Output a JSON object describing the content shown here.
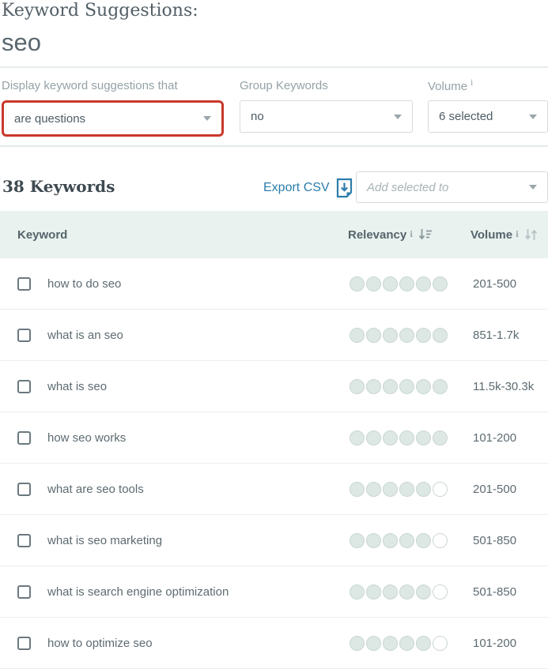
{
  "page": {
    "title": "Keyword Suggestions:",
    "query": "seo"
  },
  "filters": {
    "display": {
      "label": "Display keyword suggestions that",
      "value": "are questions",
      "highlighted": true
    },
    "group": {
      "label": "Group Keywords",
      "value": "no"
    },
    "volume": {
      "label": "Volume",
      "info_icon": "i",
      "value": "6 selected"
    }
  },
  "results": {
    "count_label": "38 Keywords",
    "export_label": "Export CSV",
    "add_selected_placeholder": "Add selected to"
  },
  "table": {
    "headers": {
      "keyword": "Keyword",
      "relevancy": "Relevancy",
      "relevancy_info_icon": "i",
      "volume": "Volume",
      "volume_info_icon": "i"
    },
    "relevancy_max": 6,
    "rows": [
      {
        "keyword": "how to do seo",
        "relevancy": 6,
        "volume": "201-500"
      },
      {
        "keyword": "what is an seo",
        "relevancy": 6,
        "volume": "851-1.7k"
      },
      {
        "keyword": "what is seo",
        "relevancy": 6,
        "volume": "11.5k-30.3k"
      },
      {
        "keyword": "how seo works",
        "relevancy": 6,
        "volume": "101-200"
      },
      {
        "keyword": "what are seo tools",
        "relevancy": 5,
        "volume": "201-500"
      },
      {
        "keyword": "what is seo marketing",
        "relevancy": 5,
        "volume": "501-850"
      },
      {
        "keyword": "what is search engine optimization",
        "relevancy": 5,
        "volume": "501-850"
      },
      {
        "keyword": "how to optimize seo",
        "relevancy": 5,
        "volume": "101-200"
      }
    ]
  },
  "icons": {
    "select_chevron": "chevron-down",
    "export": "download-document",
    "relevancy_sort": "sort-descending",
    "volume_sort": "sort-up-down",
    "info": "i"
  },
  "colors": {
    "highlight_ring": "#c9382c",
    "link_blue": "#2c7dab",
    "table_header_bg": "#e9f2ef",
    "dot_fill": "#dde7e3",
    "text_dark": "#3e4a51",
    "text_body": "#5d6b71",
    "label_gray": "#95a2a7"
  }
}
